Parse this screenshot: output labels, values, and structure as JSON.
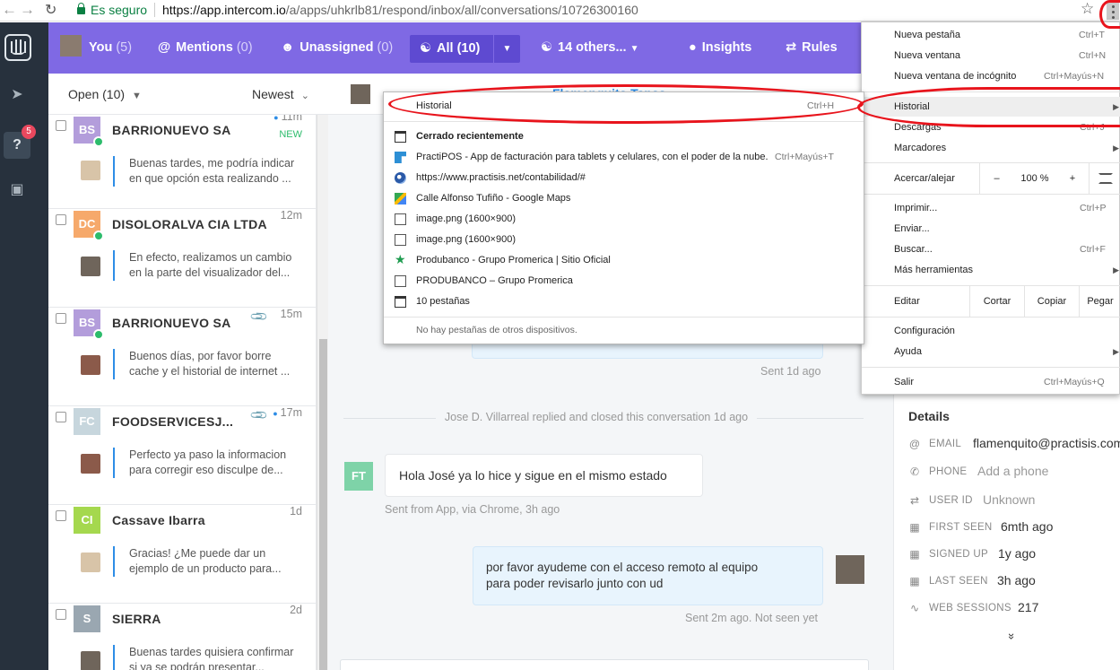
{
  "browser": {
    "secure_label": "Es seguro",
    "url_host": "https://app.intercom.io",
    "url_path": "/a/apps/uhkrlb81/respond/inbox/all/conversations/10726300160"
  },
  "rail": {
    "inbox_badge": "5"
  },
  "topnav": {
    "you": "You",
    "you_count": "(5)",
    "mentions": "Mentions",
    "mentions_count": "(0)",
    "unassigned": "Unassigned",
    "unassigned_count": "(0)",
    "all": "All",
    "all_count": "(10)",
    "others": "14 others...",
    "insights": "Insights",
    "rules": "Rules"
  },
  "list": {
    "filter": "Open (10)",
    "sort": "Newest",
    "conversations": [
      {
        "initials": "BS",
        "color": "#b39ddb",
        "name": "BARRIONUEVO SA",
        "time": "11m",
        "new": "NEW",
        "preview1": "Buenas tardes, me podría indicar",
        "preview2": "en que opción esta realizando ..."
      },
      {
        "initials": "DC",
        "color": "#f6a96b",
        "name": "DISOLORALVA CIA LTDA",
        "time": "12m",
        "preview1": "En efecto, realizamos un cambio",
        "preview2": "en la parte del visualizador del..."
      },
      {
        "initials": "BS",
        "color": "#b39ddb",
        "name": "BARRIONUEVO SA",
        "time": "15m",
        "preview1": "Buenos días, por favor borre",
        "preview2": "cache y el historial de internet ..."
      },
      {
        "initials": "FC",
        "color": "#c7d6dd",
        "name": "FOODSERVICESJ...",
        "time": "17m",
        "preview1": "Perfecto ya paso la informacion",
        "preview2": "para corregir eso disculpe de..."
      },
      {
        "initials": "CI",
        "color": "#a5d84e",
        "name": "Cassave Ibarra",
        "time": "1d",
        "preview1": "Gracias! ¿Me puede dar un",
        "preview2": "ejemplo de un producto para..."
      },
      {
        "initials": "S",
        "color": "#9aa7b1",
        "name": "SIERRA",
        "time": "2d",
        "preview1": "Buenas tardes quisiera confirmar",
        "preview2": "si ya se podrán presentar..."
      }
    ]
  },
  "conversation": {
    "title": "Flamenquito Tapas",
    "sent_1": "Sent 1d ago",
    "closed_event": "Jose D. Villarreal replied and closed this conversation 1d ago",
    "in_initials": "FT",
    "in_message": "Hola José ya lo hice y sigue en el mismo estado",
    "in_via": "Sent from App, via Chrome, 3h ago",
    "out_line1": "por favor ayudeme con el acceso remoto al equipo",
    "out_line2": "para poder revisarlo junto con ud",
    "out_status": "Sent 2m ago. Not seen yet"
  },
  "details": {
    "title": "Details",
    "email_label": "EMAIL",
    "email": "flamenquito@practisis.com",
    "phone_label": "PHONE",
    "phone": "Add a phone",
    "userid_label": "USER ID",
    "userid": "Unknown",
    "first_seen_label": "FIRST SEEN",
    "first_seen": "6mth ago",
    "signed_up_label": "SIGNED UP",
    "signed_up": "1y ago",
    "last_seen_label": "LAST SEEN",
    "last_seen": "3h ago",
    "sessions_label": "WEB SESSIONS",
    "sessions": "217",
    "more": "»"
  },
  "chrome_menu": {
    "new_tab": "Nueva pestaña",
    "new_tab_sc": "Ctrl+T",
    "new_window": "Nueva ventana",
    "new_window_sc": "Ctrl+N",
    "incognito": "Nueva ventana de incógnito",
    "incognito_sc": "Ctrl+Mayús+N",
    "history": "Historial",
    "downloads": "Descargas",
    "downloads_sc": "Ctrl+J",
    "bookmarks": "Marcadores",
    "zoom": "Acercar/alejar",
    "zoom_minus": "–",
    "zoom_value": "100 %",
    "zoom_plus": "+",
    "print": "Imprimir...",
    "print_sc": "Ctrl+P",
    "cast": "Enviar...",
    "find": "Buscar...",
    "find_sc": "Ctrl+F",
    "more_tools": "Más herramientas",
    "edit": "Editar",
    "cut": "Cortar",
    "copy": "Copiar",
    "paste": "Pegar",
    "settings": "Configuración",
    "help": "Ayuda",
    "exit": "Salir",
    "exit_sc": "Ctrl+Mayús+Q"
  },
  "history_menu": {
    "history": "Historial",
    "history_sc": "Ctrl+H",
    "recently_closed": "Cerrado recientemente",
    "items": [
      {
        "label": "PractiPOS - App de facturación para tablets y celulares, con el poder de la nube.",
        "shortcut": "Ctrl+Mayús+T",
        "icon": "practipos-icon"
      },
      {
        "label": "https://www.practisis.net/contabilidad/#",
        "icon": "globe-icon"
      },
      {
        "label": "Calle Alfonso Tufiño - Google Maps",
        "icon": "maps-icon"
      },
      {
        "label": "image.png (1600×900)",
        "icon": "document-icon"
      },
      {
        "label": "image.png (1600×900)",
        "icon": "document-icon"
      },
      {
        "label": "Produbanco - Grupo Promerica | Sitio Oficial",
        "icon": "star-icon"
      },
      {
        "label": "PRODUBANCO – Grupo Promerica",
        "icon": "document-icon"
      },
      {
        "label": "10 pestañas",
        "icon": "window-icon"
      }
    ],
    "no_devices": "No hay pestañas de otros dispositivos."
  }
}
